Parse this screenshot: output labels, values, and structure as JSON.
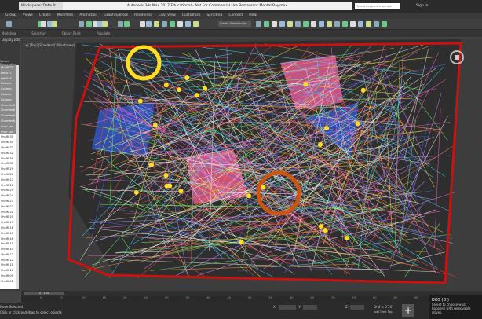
{
  "titlebar": {
    "workspace": "Workspace: Default",
    "title": "Autodesk 3ds Max 2017 Educational - Not For Commercial Use   Restaurant Mental Ray.max",
    "search_placeholder": "Type a keyword or phrase",
    "sign_in": "Sign In"
  },
  "menu": [
    "Group",
    "Views",
    "Create",
    "Modifiers",
    "Animation",
    "Graph Editors",
    "Rendering",
    "Civil View",
    "Customize",
    "Scripting",
    "Content",
    "Help"
  ],
  "toolbar": {
    "filter": "All",
    "view": "View",
    "selection_set": "Create Selection Se"
  },
  "ribbon": [
    "Modeling",
    "Selection",
    "Object Paint",
    "Populate"
  ],
  "scene_explorer": {
    "header_tabs": [
      "Display",
      "Edit"
    ],
    "sort": "Sorted Descending",
    "items": [
      "Shelf037",
      "Left017",
      "Left016",
      "Column",
      "Column",
      "Column",
      "Column",
      "ChamferB",
      "ChamferB",
      "ChamferB",
      "ChamferB",
      "rmor sai",
      "rmor sai",
      "Shelf035",
      "Shelf034",
      "Shelf033",
      "Shelf032",
      "Shelf031",
      "Shelf030",
      "Shelf029",
      "Shelf028",
      "Shelf027",
      "Shelf026",
      "Shelf025",
      "Shelf024",
      "Shelf023",
      "Shelf022",
      "Shelf021",
      "Shelf020",
      "Shelf019",
      "Shelf018",
      "Shelf017",
      "Shelf016",
      "Shelf015",
      "Shelf014",
      "Shelf013",
      "Shelf012",
      "Shelf011",
      "Shelf010",
      "Shelf009",
      "Shelf008"
    ],
    "selected_count": 13
  },
  "viewport": {
    "label": "[+] [Top] [Standard] [Wireframe]"
  },
  "timeline": {
    "slider": "0 / 100",
    "ticks": [
      "0",
      "5",
      "10",
      "15",
      "20",
      "25",
      "30",
      "35",
      "40",
      "45",
      "50",
      "55",
      "60",
      "65",
      "70",
      "75",
      "80",
      "85",
      "90",
      "95"
    ]
  },
  "status": {
    "selection": "None Selected",
    "prompt": "Click or click-and-drag to select objects",
    "x_label": "X:",
    "y_label": "Y:",
    "z_label": "Z:",
    "grid": "Grid = 0'10\"",
    "add_time_tag": "Add Time Tag"
  },
  "notification": {
    "title": "DOS (D:)",
    "body": "Select to choose what happens with removable drives."
  }
}
